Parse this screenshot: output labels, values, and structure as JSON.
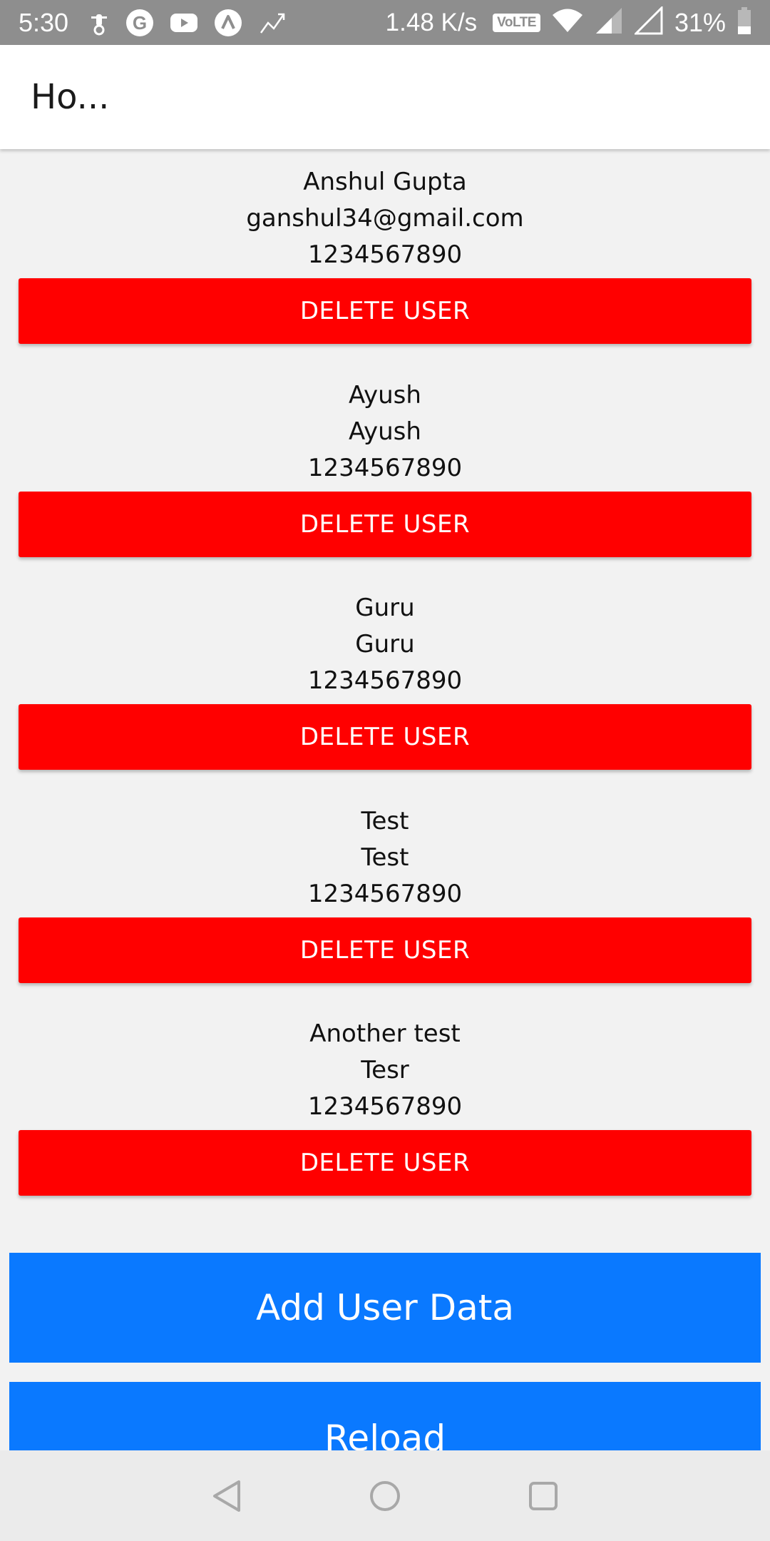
{
  "status_bar": {
    "time": "5:30",
    "network_speed": "1.48 K/s",
    "volte_label": "VoLTE",
    "battery_percent": "31%",
    "icons": [
      "bike-icon",
      "google-icon",
      "youtube-icon",
      "nav-arrow-icon",
      "trend-icon",
      "wifi-icon",
      "signal-icon",
      "signal-icon-2",
      "battery-icon"
    ]
  },
  "app_bar": {
    "title": "Ho..."
  },
  "users": [
    {
      "name": "Anshul Gupta",
      "email": "ganshul34@gmail.com",
      "phone": "1234567890",
      "delete_label": "DELETE USER"
    },
    {
      "name": "Ayush",
      "email": "Ayush",
      "phone": "1234567890",
      "delete_label": "DELETE USER"
    },
    {
      "name": "Guru",
      "email": "Guru",
      "phone": "1234567890",
      "delete_label": "DELETE USER"
    },
    {
      "name": "Test",
      "email": "Test",
      "phone": "1234567890",
      "delete_label": "DELETE USER"
    },
    {
      "name": "Another test",
      "email": "Tesr",
      "phone": "1234567890",
      "delete_label": "DELETE USER"
    }
  ],
  "actions": {
    "add_user_label": "Add User Data",
    "reload_label": "Reload"
  },
  "nav_bar": {
    "icons": [
      "back-icon",
      "home-icon",
      "recents-icon"
    ]
  },
  "colors": {
    "status_bar_bg": "#8e8e8e",
    "delete_button": "#ff0000",
    "action_button": "#0a79ff",
    "content_bg": "#f2f2f2"
  }
}
